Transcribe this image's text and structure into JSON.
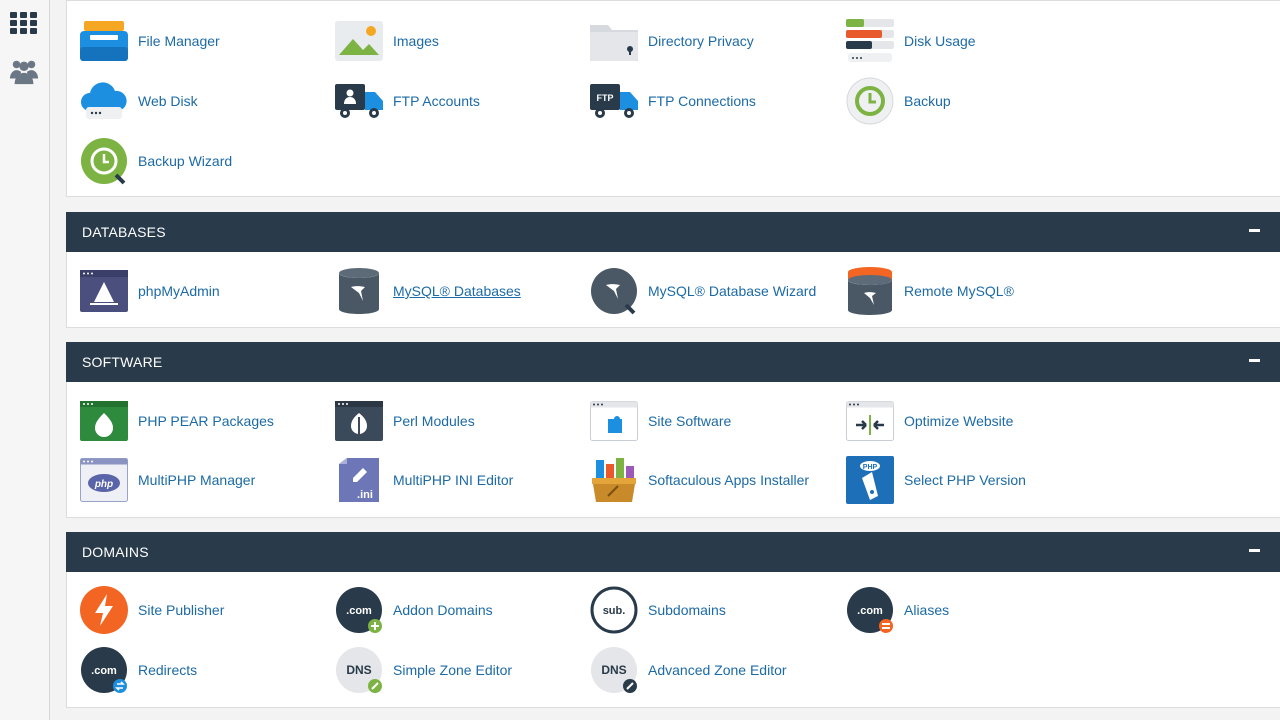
{
  "colors": {
    "header": "#293a4a",
    "link": "#1c6aa6",
    "accent_orange": "#f26522"
  },
  "sidebar": {
    "icons": [
      "apps-grid-icon",
      "users-icon"
    ]
  },
  "files": {
    "items": [
      {
        "label": "File Manager",
        "icon": "file-manager-icon"
      },
      {
        "label": "Images",
        "icon": "images-icon"
      },
      {
        "label": "Directory Privacy",
        "icon": "directory-privacy-icon"
      },
      {
        "label": "Disk Usage",
        "icon": "disk-usage-icon"
      },
      {
        "label": "Web Disk",
        "icon": "web-disk-icon"
      },
      {
        "label": "FTP Accounts",
        "icon": "ftp-accounts-icon"
      },
      {
        "label": "FTP Connections",
        "icon": "ftp-connections-icon"
      },
      {
        "label": "Backup",
        "icon": "backup-icon"
      },
      {
        "label": "Backup Wizard",
        "icon": "backup-wizard-icon"
      }
    ]
  },
  "databases": {
    "title": "DATABASES",
    "items": [
      {
        "label": "phpMyAdmin",
        "icon": "phpmyadmin-icon"
      },
      {
        "label": "MySQL® Databases",
        "icon": "mysql-databases-icon"
      },
      {
        "label": "MySQL® Database Wizard",
        "icon": "mysql-wizard-icon"
      },
      {
        "label": "Remote MySQL®",
        "icon": "remote-mysql-icon"
      }
    ]
  },
  "software": {
    "title": "SOFTWARE",
    "items": [
      {
        "label": "PHP PEAR Packages",
        "icon": "php-pear-icon"
      },
      {
        "label": "Perl Modules",
        "icon": "perl-modules-icon"
      },
      {
        "label": "Site Software",
        "icon": "site-software-icon"
      },
      {
        "label": "Optimize Website",
        "icon": "optimize-website-icon"
      },
      {
        "label": "MultiPHP Manager",
        "icon": "multiphp-manager-icon"
      },
      {
        "label": "MultiPHP INI Editor",
        "icon": "multiphp-ini-icon",
        "glyph": ".ini"
      },
      {
        "label": "Softaculous Apps Installer",
        "icon": "softaculous-icon"
      },
      {
        "label": "Select PHP Version",
        "icon": "select-php-icon",
        "glyph": "PHP"
      }
    ],
    "php_glyph": "php"
  },
  "domains": {
    "title": "DOMAINS",
    "items": [
      {
        "label": "Site Publisher",
        "icon": "site-publisher-icon"
      },
      {
        "label": "Addon Domains",
        "icon": "addon-domains-icon",
        "glyph": ".com"
      },
      {
        "label": "Subdomains",
        "icon": "subdomains-icon",
        "glyph": "sub."
      },
      {
        "label": "Aliases",
        "icon": "aliases-icon",
        "glyph": ".com"
      },
      {
        "label": "Redirects",
        "icon": "redirects-icon",
        "glyph": ".com"
      },
      {
        "label": "Simple Zone Editor",
        "icon": "simple-zone-editor-icon",
        "glyph": "DNS"
      },
      {
        "label": "Advanced Zone Editor",
        "icon": "advanced-zone-editor-icon",
        "glyph": "DNS"
      }
    ]
  }
}
